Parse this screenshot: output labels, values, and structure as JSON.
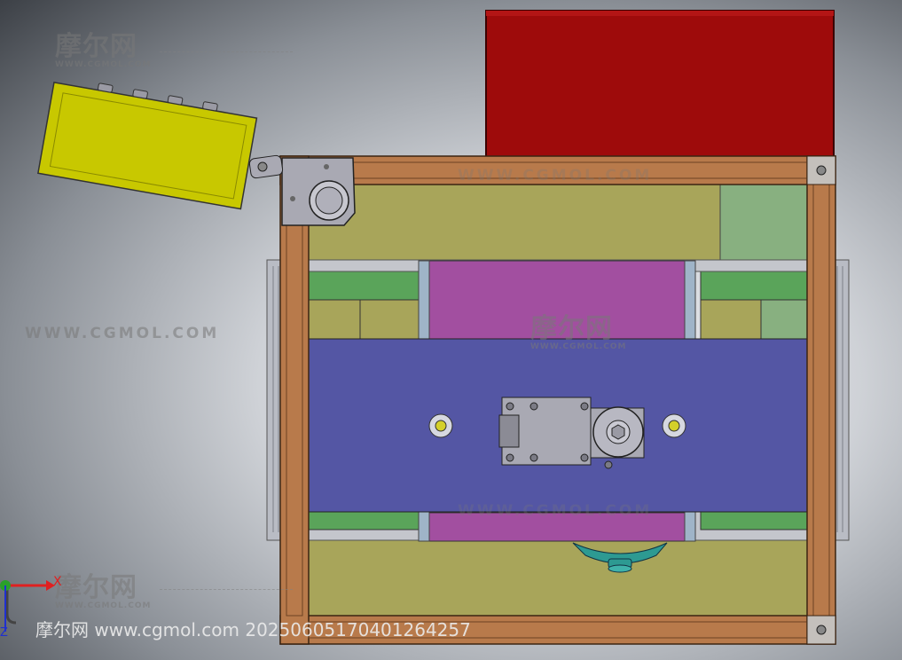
{
  "watermarks": {
    "logo": "摩尔网",
    "url": "WWW.CGMOL.COM",
    "url_wide": "WWW.CGMOL.COM"
  },
  "caption": "摩尔网 www.cgmol.com 20250605170401264257",
  "triad": {
    "x_label": "X",
    "z_label": "Z"
  },
  "colors": {
    "frame": "#b87a4b",
    "yellow_box": "#c8c800",
    "red_box": "#9e0b0b",
    "olive_panel": "#a8a55a",
    "green_rail": "#5aa45a",
    "magenta_pad": "#a24fa0",
    "blue_plate": "#5456a4",
    "teal_knob": "#2d9a92",
    "grey_part": "#a9a9b3"
  }
}
